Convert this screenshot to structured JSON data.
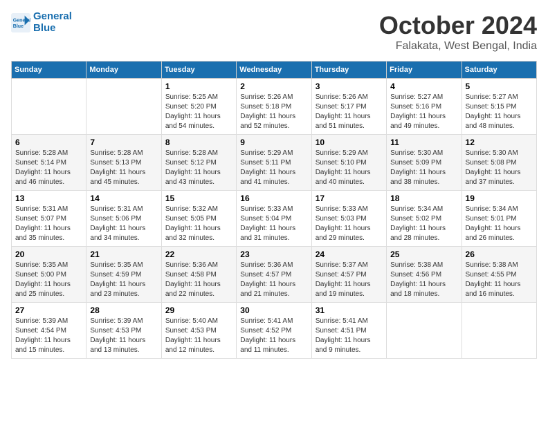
{
  "header": {
    "logo_line1": "General",
    "logo_line2": "Blue",
    "month": "October 2024",
    "location": "Falakata, West Bengal, India"
  },
  "weekdays": [
    "Sunday",
    "Monday",
    "Tuesday",
    "Wednesday",
    "Thursday",
    "Friday",
    "Saturday"
  ],
  "weeks": [
    [
      {
        "day": "",
        "sunrise": "",
        "sunset": "",
        "daylight": ""
      },
      {
        "day": "",
        "sunrise": "",
        "sunset": "",
        "daylight": ""
      },
      {
        "day": "1",
        "sunrise": "Sunrise: 5:25 AM",
        "sunset": "Sunset: 5:20 PM",
        "daylight": "Daylight: 11 hours and 54 minutes."
      },
      {
        "day": "2",
        "sunrise": "Sunrise: 5:26 AM",
        "sunset": "Sunset: 5:18 PM",
        "daylight": "Daylight: 11 hours and 52 minutes."
      },
      {
        "day": "3",
        "sunrise": "Sunrise: 5:26 AM",
        "sunset": "Sunset: 5:17 PM",
        "daylight": "Daylight: 11 hours and 51 minutes."
      },
      {
        "day": "4",
        "sunrise": "Sunrise: 5:27 AM",
        "sunset": "Sunset: 5:16 PM",
        "daylight": "Daylight: 11 hours and 49 minutes."
      },
      {
        "day": "5",
        "sunrise": "Sunrise: 5:27 AM",
        "sunset": "Sunset: 5:15 PM",
        "daylight": "Daylight: 11 hours and 48 minutes."
      }
    ],
    [
      {
        "day": "6",
        "sunrise": "Sunrise: 5:28 AM",
        "sunset": "Sunset: 5:14 PM",
        "daylight": "Daylight: 11 hours and 46 minutes."
      },
      {
        "day": "7",
        "sunrise": "Sunrise: 5:28 AM",
        "sunset": "Sunset: 5:13 PM",
        "daylight": "Daylight: 11 hours and 45 minutes."
      },
      {
        "day": "8",
        "sunrise": "Sunrise: 5:28 AM",
        "sunset": "Sunset: 5:12 PM",
        "daylight": "Daylight: 11 hours and 43 minutes."
      },
      {
        "day": "9",
        "sunrise": "Sunrise: 5:29 AM",
        "sunset": "Sunset: 5:11 PM",
        "daylight": "Daylight: 11 hours and 41 minutes."
      },
      {
        "day": "10",
        "sunrise": "Sunrise: 5:29 AM",
        "sunset": "Sunset: 5:10 PM",
        "daylight": "Daylight: 11 hours and 40 minutes."
      },
      {
        "day": "11",
        "sunrise": "Sunrise: 5:30 AM",
        "sunset": "Sunset: 5:09 PM",
        "daylight": "Daylight: 11 hours and 38 minutes."
      },
      {
        "day": "12",
        "sunrise": "Sunrise: 5:30 AM",
        "sunset": "Sunset: 5:08 PM",
        "daylight": "Daylight: 11 hours and 37 minutes."
      }
    ],
    [
      {
        "day": "13",
        "sunrise": "Sunrise: 5:31 AM",
        "sunset": "Sunset: 5:07 PM",
        "daylight": "Daylight: 11 hours and 35 minutes."
      },
      {
        "day": "14",
        "sunrise": "Sunrise: 5:31 AM",
        "sunset": "Sunset: 5:06 PM",
        "daylight": "Daylight: 11 hours and 34 minutes."
      },
      {
        "day": "15",
        "sunrise": "Sunrise: 5:32 AM",
        "sunset": "Sunset: 5:05 PM",
        "daylight": "Daylight: 11 hours and 32 minutes."
      },
      {
        "day": "16",
        "sunrise": "Sunrise: 5:33 AM",
        "sunset": "Sunset: 5:04 PM",
        "daylight": "Daylight: 11 hours and 31 minutes."
      },
      {
        "day": "17",
        "sunrise": "Sunrise: 5:33 AM",
        "sunset": "Sunset: 5:03 PM",
        "daylight": "Daylight: 11 hours and 29 minutes."
      },
      {
        "day": "18",
        "sunrise": "Sunrise: 5:34 AM",
        "sunset": "Sunset: 5:02 PM",
        "daylight": "Daylight: 11 hours and 28 minutes."
      },
      {
        "day": "19",
        "sunrise": "Sunrise: 5:34 AM",
        "sunset": "Sunset: 5:01 PM",
        "daylight": "Daylight: 11 hours and 26 minutes."
      }
    ],
    [
      {
        "day": "20",
        "sunrise": "Sunrise: 5:35 AM",
        "sunset": "Sunset: 5:00 PM",
        "daylight": "Daylight: 11 hours and 25 minutes."
      },
      {
        "day": "21",
        "sunrise": "Sunrise: 5:35 AM",
        "sunset": "Sunset: 4:59 PM",
        "daylight": "Daylight: 11 hours and 23 minutes."
      },
      {
        "day": "22",
        "sunrise": "Sunrise: 5:36 AM",
        "sunset": "Sunset: 4:58 PM",
        "daylight": "Daylight: 11 hours and 22 minutes."
      },
      {
        "day": "23",
        "sunrise": "Sunrise: 5:36 AM",
        "sunset": "Sunset: 4:57 PM",
        "daylight": "Daylight: 11 hours and 21 minutes."
      },
      {
        "day": "24",
        "sunrise": "Sunrise: 5:37 AM",
        "sunset": "Sunset: 4:57 PM",
        "daylight": "Daylight: 11 hours and 19 minutes."
      },
      {
        "day": "25",
        "sunrise": "Sunrise: 5:38 AM",
        "sunset": "Sunset: 4:56 PM",
        "daylight": "Daylight: 11 hours and 18 minutes."
      },
      {
        "day": "26",
        "sunrise": "Sunrise: 5:38 AM",
        "sunset": "Sunset: 4:55 PM",
        "daylight": "Daylight: 11 hours and 16 minutes."
      }
    ],
    [
      {
        "day": "27",
        "sunrise": "Sunrise: 5:39 AM",
        "sunset": "Sunset: 4:54 PM",
        "daylight": "Daylight: 11 hours and 15 minutes."
      },
      {
        "day": "28",
        "sunrise": "Sunrise: 5:39 AM",
        "sunset": "Sunset: 4:53 PM",
        "daylight": "Daylight: 11 hours and 13 minutes."
      },
      {
        "day": "29",
        "sunrise": "Sunrise: 5:40 AM",
        "sunset": "Sunset: 4:53 PM",
        "daylight": "Daylight: 11 hours and 12 minutes."
      },
      {
        "day": "30",
        "sunrise": "Sunrise: 5:41 AM",
        "sunset": "Sunset: 4:52 PM",
        "daylight": "Daylight: 11 hours and 11 minutes."
      },
      {
        "day": "31",
        "sunrise": "Sunrise: 5:41 AM",
        "sunset": "Sunset: 4:51 PM",
        "daylight": "Daylight: 11 hours and 9 minutes."
      },
      {
        "day": "",
        "sunrise": "",
        "sunset": "",
        "daylight": ""
      },
      {
        "day": "",
        "sunrise": "",
        "sunset": "",
        "daylight": ""
      }
    ]
  ]
}
